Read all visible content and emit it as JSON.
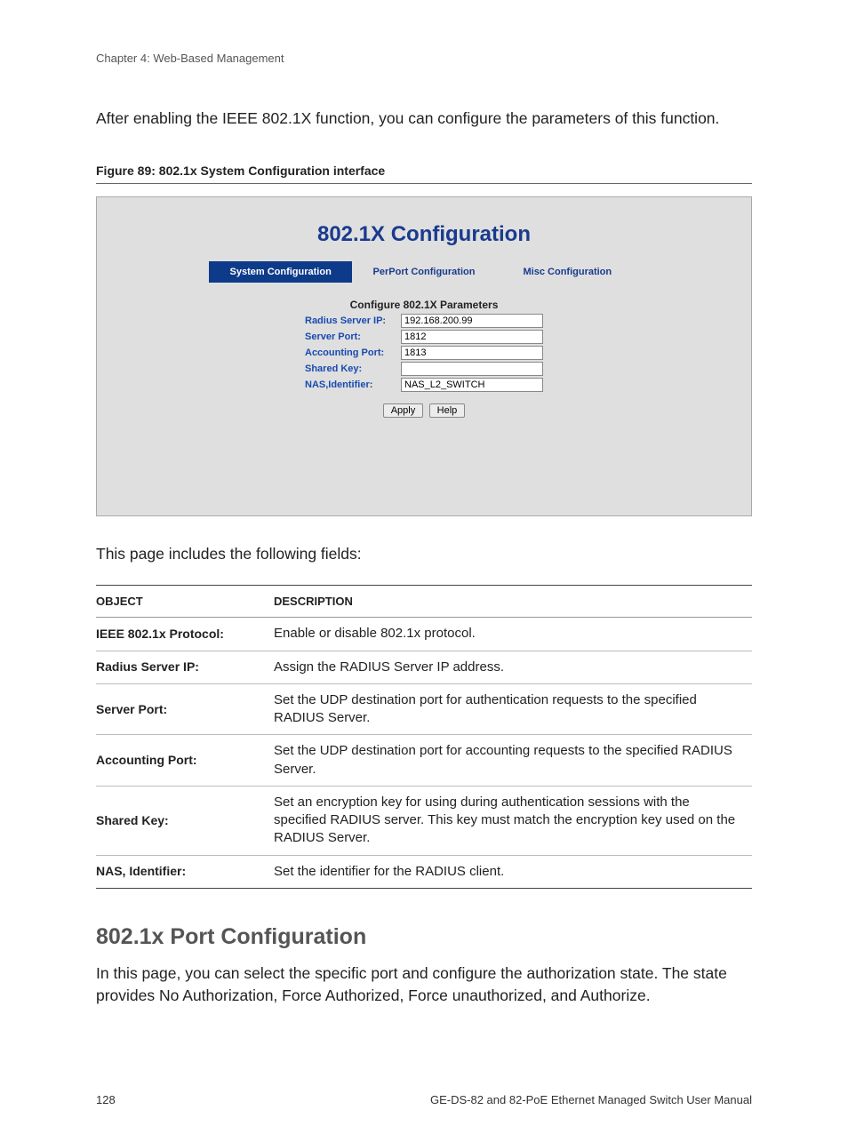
{
  "chapter": "Chapter 4: Web-Based Management",
  "intro": "After enabling the IEEE 802.1X function, you can configure the parameters of this function.",
  "figure_caption": "Figure 89: 802.1x System Configuration interface",
  "screenshot": {
    "title": "802.1X Configuration",
    "tabs": {
      "system": "System Configuration",
      "perport": "PerPort Configuration",
      "misc": "Misc Configuration"
    },
    "params_heading": "Configure 802.1X Parameters",
    "rows": {
      "radius_ip": {
        "label": "Radius Server IP:",
        "value": "192.168.200.99"
      },
      "server_port": {
        "label": "Server Port:",
        "value": "1812"
      },
      "acct_port": {
        "label": "Accounting Port:",
        "value": "1813"
      },
      "shared_key": {
        "label": "Shared Key:",
        "value": ""
      },
      "nas_id": {
        "label": "NAS,Identifier:",
        "value": "NAS_L2_SWITCH"
      }
    },
    "buttons": {
      "apply": "Apply",
      "help": "Help"
    }
  },
  "after_shot": "This page includes the following fields:",
  "table": {
    "head_object": "OBJECT",
    "head_desc": "DESCRIPTION",
    "rows": [
      {
        "obj": "IEEE 802.1x Protocol:",
        "desc": "Enable or disable 802.1x protocol."
      },
      {
        "obj": "Radius Server IP:",
        "desc": "Assign the RADIUS Server IP address."
      },
      {
        "obj": "Server Port:",
        "desc": "Set the UDP destination port for authentication requests to the specified RADIUS Server."
      },
      {
        "obj": "Accounting Port:",
        "desc": "Set the UDP destination port for accounting requests to the specified RADIUS Server."
      },
      {
        "obj": "Shared Key:",
        "desc": "Set an encryption key for using during authentication sessions with the specified RADIUS server. This key must match the encryption key used on the RADIUS Server."
      },
      {
        "obj": "NAS, Identifier:",
        "desc": "Set the identifier for the RADIUS client."
      }
    ]
  },
  "section": {
    "heading": "802.1x Port Configuration",
    "body": "In this page, you can select the specific port and configure the authorization state. The state provides No Authorization, Force Authorized, Force unauthorized, and Authorize."
  },
  "footer": {
    "page": "128",
    "manual": "GE-DS-82 and 82-PoE Ethernet Managed Switch User Manual"
  }
}
